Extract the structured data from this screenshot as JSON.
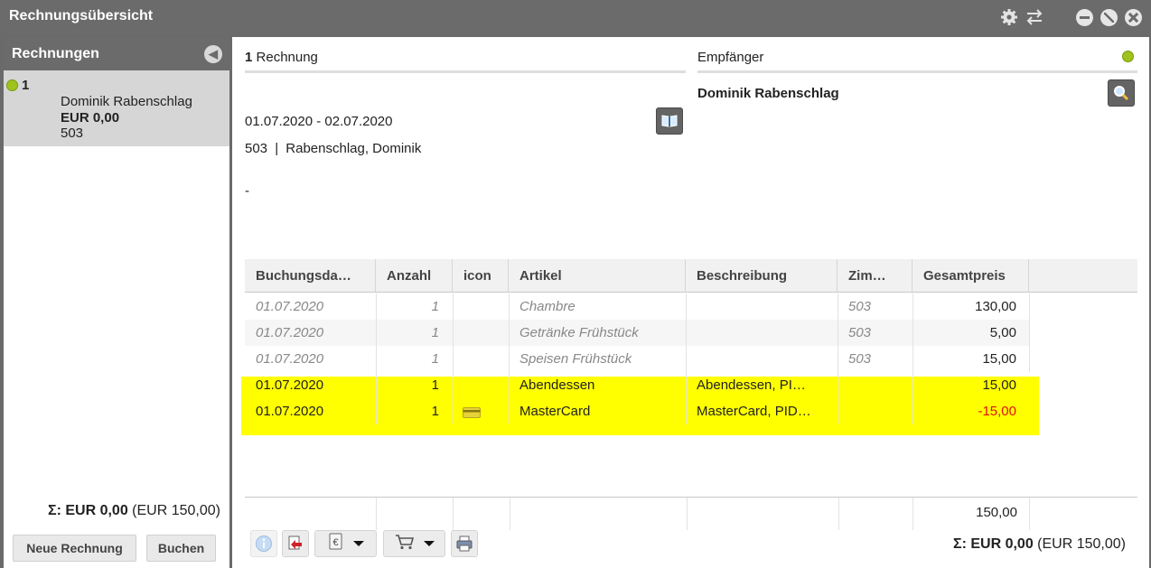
{
  "window": {
    "title": "Rechnungsübersicht",
    "icons": [
      "gear-icon",
      "swap-icon",
      "minimize-icon",
      "restore-icon",
      "close-icon"
    ]
  },
  "sidebar": {
    "title": "Rechnungen",
    "items": [
      {
        "number": "1",
        "name": "Dominik Rabenschlag",
        "amount": "EUR 0,00",
        "room": "503",
        "status_color": "#9fc21c"
      }
    ],
    "total_sigma": "Σ: EUR 0,00",
    "total_gross": "(EUR 150,00)",
    "new_invoice_label": "Neue Rechnung",
    "book_label": "Buchen"
  },
  "invoice": {
    "count": "1",
    "count_label": "Rechnung",
    "period": "01.07.2020 - 02.07.2020",
    "room": "503",
    "room_sep": "|",
    "guest": "Rabenschlag, Dominik",
    "note": "-"
  },
  "recipient": {
    "label": "Empfänger",
    "name": "Dominik Rabenschlag",
    "status_color": "#9fc21c"
  },
  "table": {
    "columns": [
      "Buchungsda…",
      "Anzahl",
      "icon",
      "Artikel",
      "Beschreibung",
      "Zim…",
      "Gesamtpreis"
    ],
    "rows": [
      {
        "date": "01.07.2020",
        "qty": "1",
        "icon": "",
        "article": "Chambre",
        "desc": "",
        "room": "503",
        "total": "130,00",
        "muted": true
      },
      {
        "date": "01.07.2020",
        "qty": "1",
        "icon": "",
        "article": "Getränke Frühstück",
        "desc": "",
        "room": "503",
        "total": "5,00",
        "muted": true
      },
      {
        "date": "01.07.2020",
        "qty": "1",
        "icon": "",
        "article": "Speisen Frühstück",
        "desc": "",
        "room": "503",
        "total": "15,00",
        "muted": true
      },
      {
        "date": "01.07.2020",
        "qty": "1",
        "icon": "",
        "article": "Abendessen",
        "desc": "Abendessen, PI…",
        "room": "",
        "total": "15,00",
        "muted": false
      },
      {
        "date": "01.07.2020",
        "qty": "1",
        "icon": "credit-card-icon",
        "article": "MasterCard",
        "desc": "MasterCard, PID…",
        "room": "",
        "total": "-15,00",
        "muted": false,
        "negative": true
      }
    ],
    "sum": "150,00",
    "highlight_color": "#ffff00"
  },
  "footer": {
    "total_sigma": "Σ: EUR 0,00",
    "total_gross": "(EUR 150,00)",
    "tools": [
      "info-icon",
      "split-invoice-icon",
      "payment-icon",
      "cart-icon",
      "print-icon"
    ]
  }
}
